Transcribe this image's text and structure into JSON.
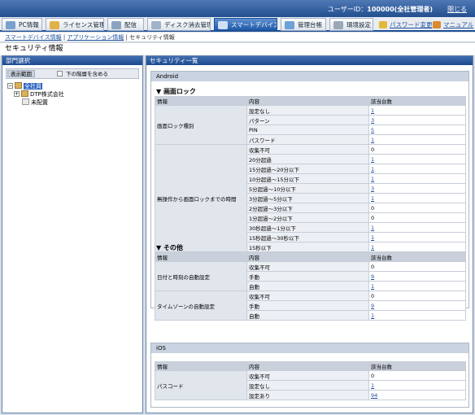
{
  "header": {
    "user_label": "ユーザーID：",
    "user_value": "100000(全社管理者)",
    "logout": "閉じる"
  },
  "tabs": [
    {
      "label": "PC情報"
    },
    {
      "label": "ライセンス管理"
    },
    {
      "label": "配信"
    },
    {
      "label": "ディスク消去管理"
    },
    {
      "label": "スマートデバイス"
    },
    {
      "label": "管理台帳"
    },
    {
      "label": "環境設定"
    }
  ],
  "right_links": [
    {
      "label": "パスワード変更"
    },
    {
      "label": "マニュアル"
    }
  ],
  "subnav": {
    "link1": "スマートデバイス情報",
    "link2": "アプリケーション情報",
    "current": "セキュリティ情報"
  },
  "page_title": "セキュリティ情報",
  "left": {
    "header": "部門選択",
    "scope_label": "表示範囲",
    "include_sub": "下の階層を含める",
    "tree": {
      "root": "全社員",
      "child": "DTP株式会社",
      "unassigned": "未配置"
    }
  },
  "right": {
    "header": "セキュリティ一覧",
    "android": {
      "name": "Android",
      "screen_lock": {
        "title": "画面ロック",
        "cols": [
          "情報",
          "内容",
          "該当台数"
        ],
        "group1": "画面ロック種別",
        "rows1": [
          {
            "content": "設定なし",
            "count": "1"
          },
          {
            "content": "パターン",
            "count": "3"
          },
          {
            "content": "PIN",
            "count": "5"
          },
          {
            "content": "パスワード",
            "count": "1"
          }
        ],
        "group2": "無操作から画面ロックまでの時間",
        "rows2": [
          {
            "content": "収集不可",
            "count": "0"
          },
          {
            "content": "20分超過",
            "count": "1"
          },
          {
            "content": "15分超過～20分以下",
            "count": "1"
          },
          {
            "content": "10分超過～15分以下",
            "count": "1"
          },
          {
            "content": "5分超過～10分以下",
            "count": "3"
          },
          {
            "content": "3分超過～5分以下",
            "count": "1"
          },
          {
            "content": "2分超過～3分以下",
            "count": "0"
          },
          {
            "content": "1分超過～2分以下",
            "count": "0"
          },
          {
            "content": "30秒超過～1分以下",
            "count": "1"
          },
          {
            "content": "15秒超過～30秒以下",
            "count": "1"
          },
          {
            "content": "15秒以下",
            "count": "1"
          }
        ]
      },
      "other": {
        "title": "その他",
        "cols": [
          "情報",
          "内容",
          "該当台数"
        ],
        "group1": "日付と時刻の自動設定",
        "rows1": [
          {
            "content": "収集不可",
            "count": "0"
          },
          {
            "content": "手動",
            "count": "9"
          },
          {
            "content": "自動",
            "count": "1"
          }
        ],
        "group2": "タイムゾーンの自動設定",
        "rows2": [
          {
            "content": "収集不可",
            "count": "0"
          },
          {
            "content": "手動",
            "count": "9"
          },
          {
            "content": "自動",
            "count": "1"
          }
        ]
      }
    },
    "ios": {
      "name": "iOS",
      "cols": [
        "情報",
        "内容",
        "該当台数"
      ],
      "group1": "パスコード",
      "rows1": [
        {
          "content": "収集不可",
          "count": "0"
        },
        {
          "content": "設定なし",
          "count": "1"
        },
        {
          "content": "設定あり",
          "count": "94"
        }
      ]
    }
  },
  "colors": {
    "accent": "#1f4f95",
    "link": "#1d4f9d"
  }
}
